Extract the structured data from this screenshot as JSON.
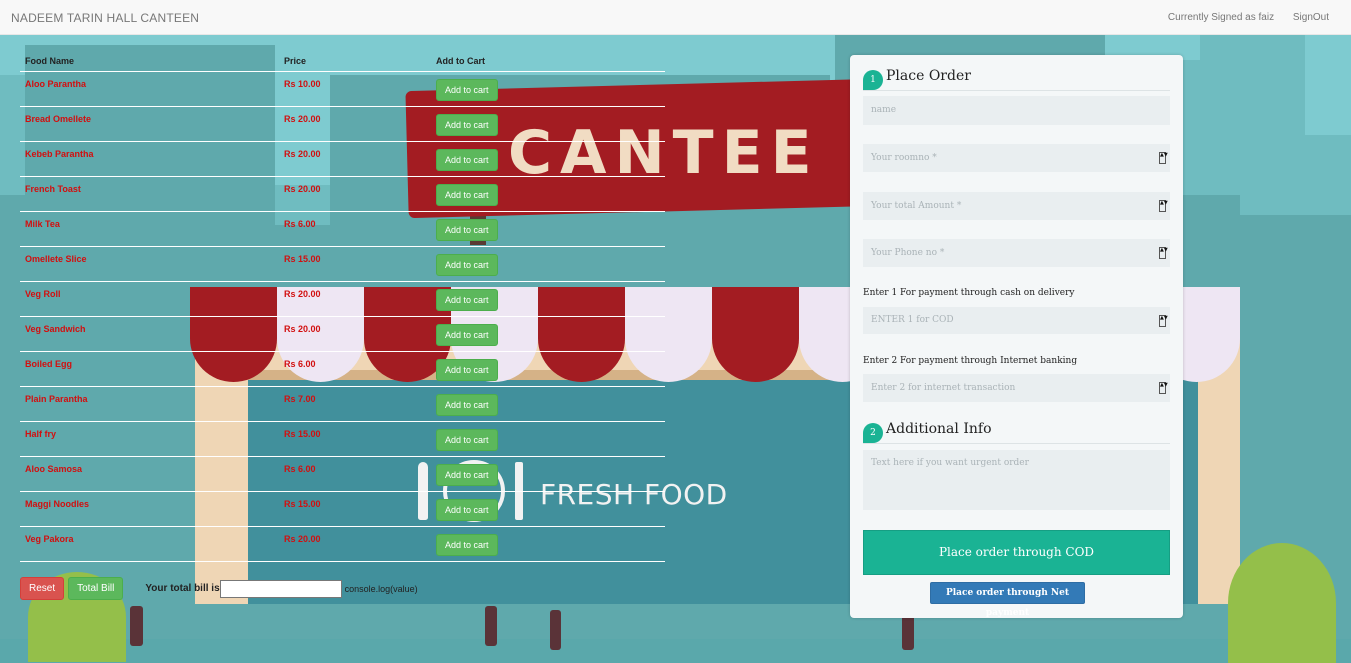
{
  "navbar": {
    "brand": "NADEEM TARIN HALL CANTEEN",
    "signed_in": "Currently Signed as faiz",
    "signout": "SignOut"
  },
  "background": {
    "sign_text": "CANTEE",
    "tagline": "FRESH FOOD"
  },
  "menu": {
    "headers": [
      "Food Name",
      "Price",
      "Add to Cart"
    ],
    "add_label": "Add to cart",
    "items": [
      {
        "name": "Aloo Parantha",
        "price": "Rs 10.00"
      },
      {
        "name": "Bread Omellete",
        "price": "Rs 20.00"
      },
      {
        "name": "Kebeb Parantha",
        "price": "Rs 20.00"
      },
      {
        "name": "French Toast",
        "price": "Rs 20.00"
      },
      {
        "name": "Milk Tea",
        "price": "Rs 6.00"
      },
      {
        "name": "Omellete Slice",
        "price": "Rs 15.00"
      },
      {
        "name": "Veg Roll",
        "price": "Rs 20.00"
      },
      {
        "name": "Veg Sandwich",
        "price": "Rs 20.00"
      },
      {
        "name": "Boiled Egg",
        "price": "Rs 6.00"
      },
      {
        "name": "Plain Parantha",
        "price": "Rs 7.00"
      },
      {
        "name": "Half fry",
        "price": "Rs 15.00"
      },
      {
        "name": "Aloo Samosa",
        "price": "Rs 6.00"
      },
      {
        "name": "Maggi Noodles",
        "price": "Rs 15.00"
      },
      {
        "name": "Veg Pakora",
        "price": "Rs 20.00"
      }
    ]
  },
  "controls": {
    "reset": "Reset",
    "total": "Total Bill",
    "bill_label": "Your total bill is",
    "bill_value": "",
    "console": "console.log(value)"
  },
  "order": {
    "section1_num": "1",
    "section1_title": "Place Order",
    "name_placeholder": "name",
    "room_placeholder": "Your roomno *",
    "amount_placeholder": "Your total Amount *",
    "phone_placeholder": "Your Phone no *",
    "cod_label": "Enter 1 For payment through cash on delivery",
    "cod_placeholder": "ENTER 1 for COD",
    "net_label": "Enter 2 For payment through Internet banking",
    "net_placeholder": "Enter 2 for internet transaction",
    "section2_num": "2",
    "section2_title": "Additional Info",
    "info_placeholder": "Text here if you want urgent order",
    "cod_button": "Place order through COD",
    "net_button": "Place order through Net payment"
  },
  "colors": {
    "accent": "#1ab394",
    "add_button": "#5cb85c",
    "price_text": "#d20f0f",
    "reset_button": "#d9534f",
    "net_button": "#337ab7"
  }
}
